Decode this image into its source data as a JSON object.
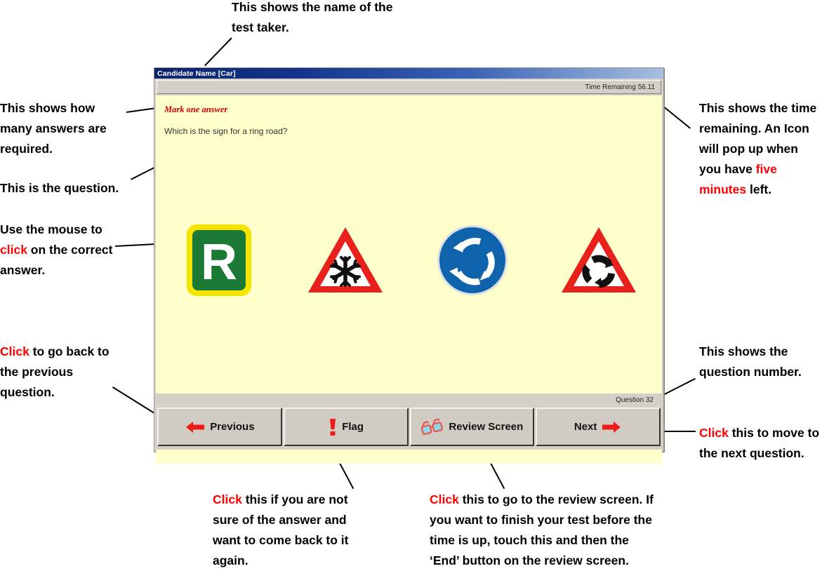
{
  "window": {
    "title": "Candidate Name [Car]",
    "time_remaining": "Time Remaining 56.11",
    "mark_instruction": "Mark one answer",
    "question_text": "Which is the sign for a ring road?",
    "question_number": "Question 32",
    "content_bg": "#ffffcc",
    "titlebar_start": "#0a246a",
    "titlebar_end": "#a6bee0"
  },
  "answers": [
    {
      "id": "ring-road-sign",
      "icon": "green-r-rectangle-sign",
      "alt": "Green rectangular sign with white letter R and yellow border"
    },
    {
      "id": "ice-warning-sign",
      "icon": "snowflake-triangle-sign",
      "alt": "Red warning triangle with black snowflake"
    },
    {
      "id": "mini-roundabout-sign",
      "icon": "blue-roundabout-circle-sign",
      "alt": "Blue circular sign with three white curved arrows"
    },
    {
      "id": "roundabout-ahead-sign",
      "icon": "roundabout-triangle-sign",
      "alt": "Red warning triangle with black roundabout symbol"
    }
  ],
  "buttons": {
    "previous": "Previous",
    "flag": "Flag",
    "review": "Review Screen",
    "next": "Next"
  },
  "annotations": {
    "name": {
      "pre": "This shows the name of the test taker.",
      "red": "",
      "post": ""
    },
    "answers_required": {
      "pre": "This shows how many answers are required.",
      "red": "",
      "post": ""
    },
    "question": {
      "pre": "This is the question.",
      "red": "",
      "post": ""
    },
    "mouse": {
      "pre": "Use the mouse to ",
      "red": "click",
      "post": " on the correct answer."
    },
    "previous": {
      "pre": "",
      "red": "Click",
      "post": " to go back to the previous question."
    },
    "time": {
      "pre": "This shows the time remaining. An Icon will pop up when you have ",
      "red": "five minutes",
      "post": " left."
    },
    "question_number": {
      "pre": "This shows the question number.",
      "red": "",
      "post": ""
    },
    "next": {
      "pre": "",
      "red": "Click",
      "post": " this to move to the next question."
    },
    "flag": {
      "pre": "",
      "red": "Click",
      "post": " this if you are not sure of the answer and want to come back to it again."
    },
    "review": {
      "pre": "",
      "red": "Click",
      "post": " this to go to the review screen. If you want to finish your test before the time is up, touch this and then the ‘End’ button on the review screen."
    }
  },
  "colors": {
    "accent_red": "#ff0000",
    "sign_red": "#e8211d",
    "sign_green": "#1b7a35",
    "sign_blue": "#0f63ad",
    "sign_yellow": "#f5e400"
  }
}
